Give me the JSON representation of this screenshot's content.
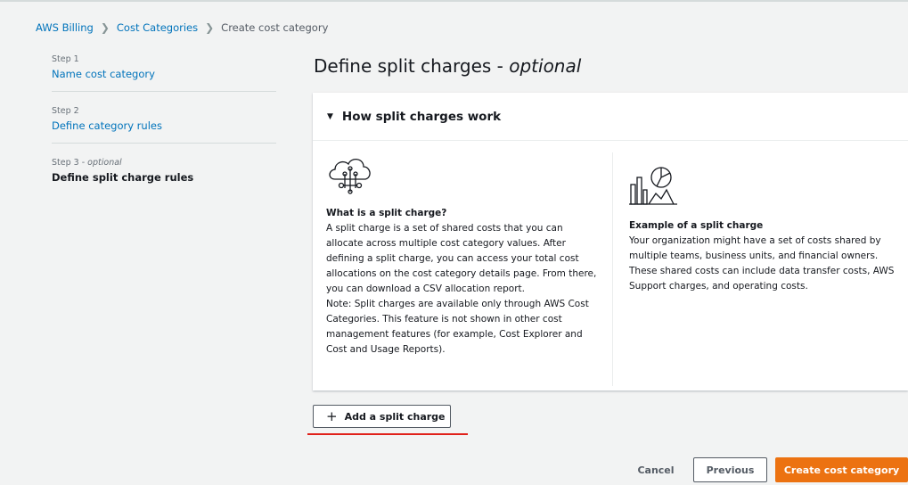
{
  "breadcrumb": {
    "items": [
      "AWS Billing",
      "Cost Categories"
    ],
    "current": "Create cost category"
  },
  "steps": [
    {
      "label": "Step 1",
      "title": "Name cost category"
    },
    {
      "label": "Step 2",
      "title": "Define category rules"
    },
    {
      "label": "Step 3",
      "label_suffix": "optional",
      "title": "Define split charge rules"
    }
  ],
  "page": {
    "title": "Define split charges",
    "title_suffix": "optional"
  },
  "panel": {
    "title": "How split charges work",
    "left": {
      "icon": "cloud-network-icon",
      "title": "What is a split charge?",
      "body": "A split charge is a set of shared costs that you can allocate across multiple cost category values. After defining a split charge, you can access your total cost allocations on the cost category details page. From there, you can download a CSV allocation report.",
      "note": "Note: Split charges are available only through AWS Cost Categories. This feature is not shown in other cost management features (for example, Cost Explorer and Cost and Usage Reports)."
    },
    "right": {
      "icon": "chart-analytics-icon",
      "title": "Example of a split charge",
      "body": "Your organization might have a set of costs shared by multiple teams, business units, and financial owners. These shared costs can include data transfer costs, AWS Support charges, and operating costs."
    }
  },
  "actions": {
    "add_split_charge": "Add a split charge",
    "cancel": "Cancel",
    "previous": "Previous",
    "create": "Create cost category"
  },
  "colors": {
    "link": "#0073bb",
    "primary_button": "#ec7211",
    "highlight_underline": "#e0201a"
  }
}
